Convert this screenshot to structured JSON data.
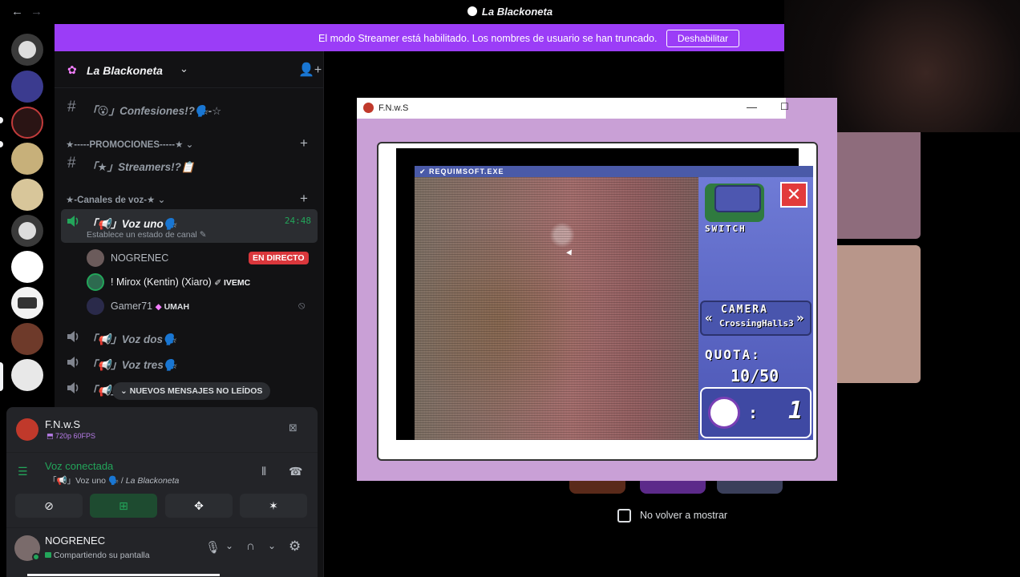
{
  "window": {
    "title": "La Blackoneta",
    "back_icon": "←",
    "forward_icon": "→"
  },
  "banner": {
    "text": "El modo Streamer está habilitado. Los nombres de usuario se han truncado.",
    "button": "Deshabilitar"
  },
  "server": {
    "name": "La Blackoneta"
  },
  "channels": {
    "partial_top": "┋ ...",
    "confesiones": "「😮」Confesiones!?🗣️-☆",
    "cat_promociones": "★-----PROMOCIONES-----★",
    "streamers": "「★」Streamers!?📋",
    "cat_voz": "★-Canales de voz-★",
    "voz_uno": "「📢」Voz uno🗣️",
    "voz_uno_timer": "24:48",
    "voz_uno_status": "Establece un estado de canal",
    "voz_dos": "「📢」Voz dos🗣️",
    "voz_tres": "「📢」Voz tres🗣️",
    "voz_cuatro_partial": "「📢」"
  },
  "voice_users": [
    {
      "name": "NOGRENEC",
      "badge": "EN DIRECTO"
    },
    {
      "name": "! Mirox (Kentin) (Xiaro)",
      "tag": "IVEMC"
    },
    {
      "name": "Gamer71",
      "tag": "UMAH"
    }
  ],
  "unread_pill": "NUEVOS MENSAJES NO LEÍDOS",
  "stream": {
    "app": "F.N.w.S",
    "quality": "720p 60FPS"
  },
  "voice": {
    "status": "Voz conectada",
    "channel": "「📢」Voz uno 🗣️",
    "server": "La Blackoneta"
  },
  "user": {
    "name": "NOGRENEC",
    "status": "Compartiendo su pantalla"
  },
  "game": {
    "window_title": "F.N.w.S",
    "header": "REQUIMSOFT.EXE",
    "switch_label": "SWITCH",
    "camera_label": "CAMERA",
    "camera_name": "CrossingHalls3",
    "quota_label": "QUOTA:",
    "quota_value": "10/50",
    "counter": "1"
  },
  "dialog": {
    "dont_show": "No volver a mostrar"
  },
  "colors": {
    "accent": "#9b3df7",
    "live": "#da373c",
    "online": "#23a55a",
    "hud": "#5a66c8"
  }
}
